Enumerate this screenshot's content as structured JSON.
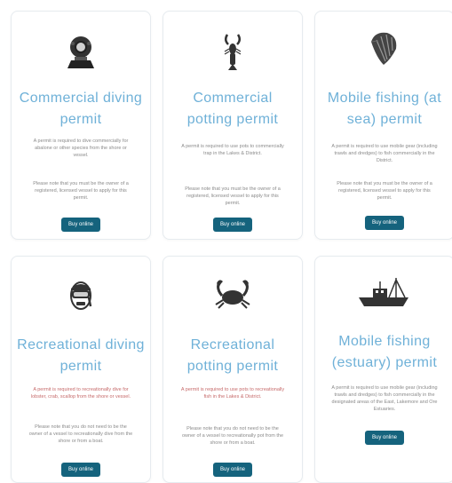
{
  "cards": [
    {
      "title": "Commercial diving permit",
      "desc": "A permit is required to dive commercially for abalone or other species from the shore or vessel.",
      "note": "Please note that you must be the owner of a registered, licensed vessel to apply for this permit.",
      "button": "Buy online",
      "icon": "diving-helmet-icon"
    },
    {
      "title": "Commercial potting permit",
      "desc": "A permit is required to use pots to commercially trap in the Lakes & District.",
      "note": "Please note that you must be the owner of a registered, licensed vessel to apply for this permit.",
      "button": "Buy online",
      "icon": "lobster-icon"
    },
    {
      "title": "Mobile fishing (at sea) permit",
      "desc": "A permit is required to use mobile gear (including trawls and dredges) to fish commercially in the District.",
      "note": "Please note that you must be the owner of a registered, licensed vessel to apply for this permit.",
      "button": "Buy online",
      "icon": "scallop-shell-icon"
    },
    {
      "title": "Recreational diving permit",
      "desc": "A permit is required to recreationally dive for lobster, crab, scallop from the shore or vessel.",
      "note": "Please note that you do not need to be the owner of a vessel to recreationally dive from the shore or from a boat.",
      "button": "Buy online",
      "icon": "diver-mask-icon"
    },
    {
      "title": "Recreational potting permit",
      "desc": "A permit is required to use pots to recreationally fish in the Lakes & District.",
      "note": "Please note that you do not need to be the owner of a vessel to recreationally pot from the shore or from a boat.",
      "button": "Buy online",
      "icon": "crab-icon"
    },
    {
      "title": "Mobile fishing (estuary) permit",
      "desc": "A permit is required to use mobile gear (including trawls and dredges) to fish commercially in the designated areas of the East, Lakemore and Ore Estuaries.",
      "note": "",
      "button": "Buy online",
      "icon": "fishing-boat-icon"
    }
  ],
  "colors": {
    "title": "#6fb1d8",
    "button": "#15637d",
    "text": "#8a8a8a",
    "red_text": "#c66a6a"
  }
}
